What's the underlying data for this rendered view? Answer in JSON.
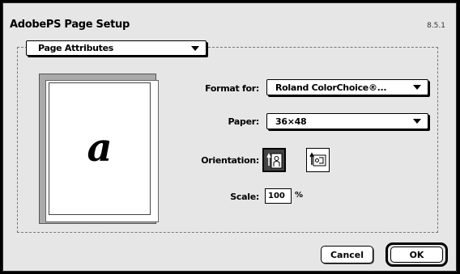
{
  "dialog": {
    "title": "AdobePS Page Setup",
    "version": "8.5.1"
  },
  "panel_popup": {
    "value": "Page Attributes"
  },
  "preview": {
    "letter": "a"
  },
  "format_for": {
    "label": "Format for:",
    "value": "Roland ColorChoice®..."
  },
  "paper": {
    "label": "Paper:",
    "value": "36×48"
  },
  "orientation": {
    "label": "Orientation:",
    "options": [
      "portrait",
      "landscape"
    ],
    "selected": "portrait"
  },
  "scale": {
    "label": "Scale:",
    "value": "100",
    "unit": "%"
  },
  "buttons": {
    "cancel": "Cancel",
    "ok": "OK"
  }
}
